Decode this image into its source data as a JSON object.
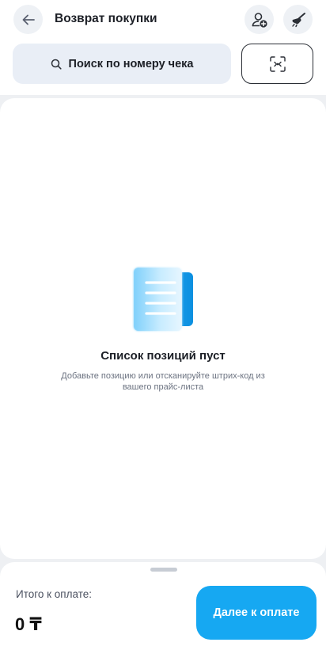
{
  "header": {
    "title": "Возврат покупки",
    "back_icon": "arrow-left-icon",
    "add_client_icon": "user-add-icon",
    "cleaner_icon": "broom-icon"
  },
  "search": {
    "label": "Поиск по номеру чека",
    "icon": "search-icon",
    "scan_icon": "scan-frame-icon"
  },
  "empty_state": {
    "illustration": "document-list-icon",
    "title": "Список позиций пуст",
    "subtitle": "Добавьте позицию или отсканируйте штрих-код из вашего прайс-листа"
  },
  "footer": {
    "total_label": "Итого к оплате:",
    "total_value": "0 ₸",
    "pay_button": "Далее к оплате"
  },
  "colors": {
    "accent": "#16a8f2",
    "search_bg": "#e9eef6",
    "page_bg": "#eef0f3"
  }
}
